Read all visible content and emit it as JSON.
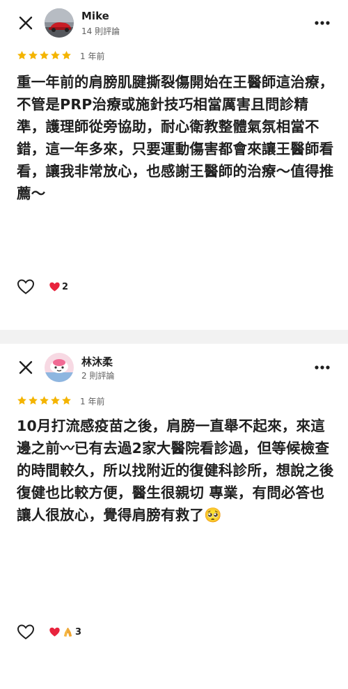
{
  "reviews": [
    {
      "reviewer": "Mike",
      "review_count": "14 則評論",
      "rating": 5,
      "time": "1 年前",
      "text": "重一年前的肩膀肌腱撕裂傷開始在王醫師這治療，不管是PRP治療或施針技巧相當厲害且問診精準，護理師從旁協助，耐心衛教整體氣氛相當不錯，這一年多來，只要運動傷害都會來讓王醫師看看，讓我非常放心，也感謝王醫師的治療～值得推薦～",
      "reactions": [
        "heart"
      ],
      "reaction_count": "2",
      "avatar_icon": "car-photo-avatar"
    },
    {
      "reviewer": "林沐柔",
      "review_count": "2 則評論",
      "rating": 5,
      "time": "1 年前",
      "text": "10月打流感疫苗之後，肩膀一直舉不起來，來這邊之前〰已有去過2家大醫院看診過，但等候檢查的時間較久，所以找附近的復健科診所，想說之後復健也比較方便，醫生很親切 專業，有問必答也讓人很放心，覺得肩膀有救了🥺",
      "reactions": [
        "heart",
        "folded-hands"
      ],
      "reaction_count": "3",
      "avatar_icon": "cartoon-avatar"
    }
  ],
  "colors": {
    "star": "#f4b400",
    "heart": "#e8233d",
    "text": "#1f1f1f",
    "muted": "#5f5f5f"
  }
}
